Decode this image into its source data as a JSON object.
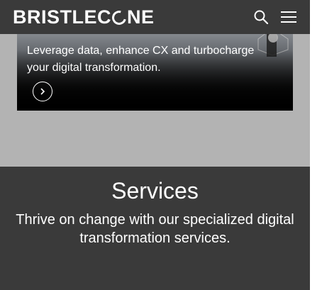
{
  "header": {
    "logo_text_left": "BRISTLEC",
    "logo_text_right": "NE",
    "search_icon": "search-icon",
    "menu_icon": "hamburger-menu-icon"
  },
  "hero": {
    "text": "Leverage data, enhance CX and turbocharge your digital transformation.",
    "arrow_icon": "chevron-right-icon"
  },
  "services": {
    "title": "Services",
    "description": "Thrive on change with our specialized digital transformation services."
  },
  "colors": {
    "header_bg": "#3a3a3a",
    "page_bg": "#b3b3b3",
    "services_bg": "#3a3a3a",
    "text": "#ffffff"
  }
}
